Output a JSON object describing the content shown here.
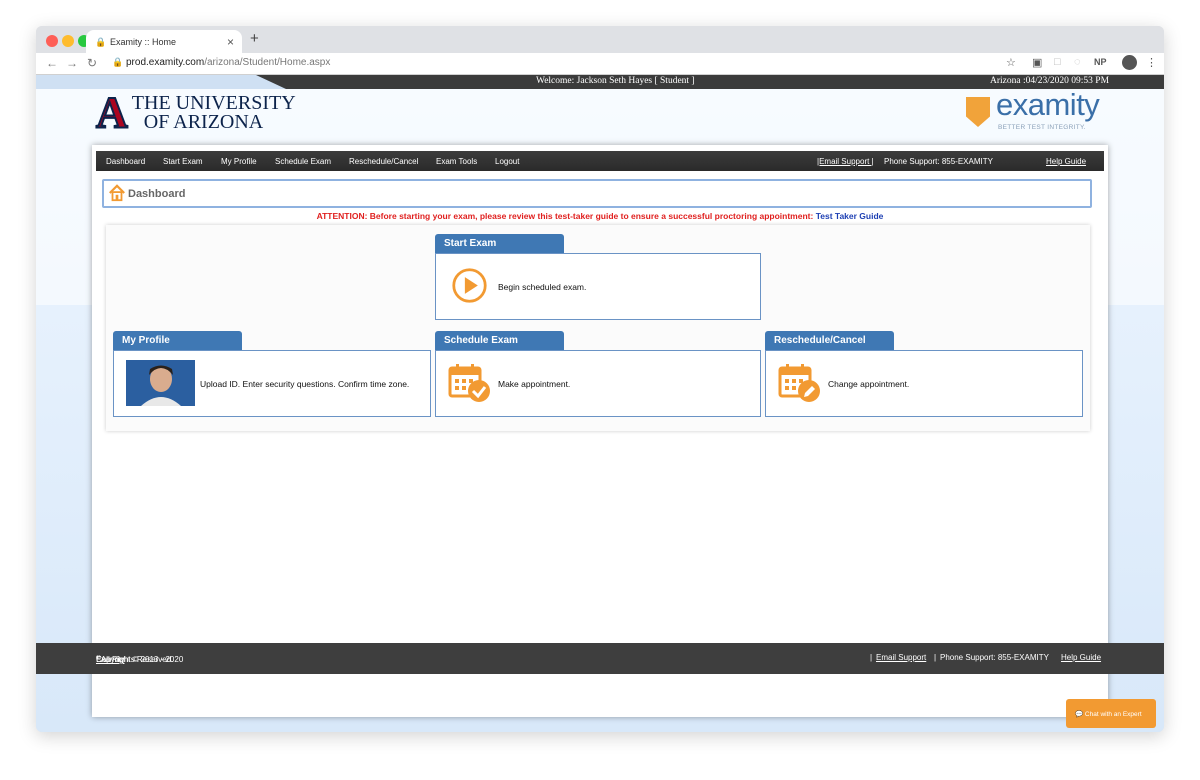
{
  "browser": {
    "tab_title": "Examity :: Home",
    "new_tab": "+",
    "url_host": "prod.examity.com",
    "url_path": "/arizona/Student/Home.aspx",
    "profile_initials": "NP"
  },
  "topbar": {
    "welcome": "Welcome: Jackson Seth Hayes [ Student ]",
    "datetime": "Arizona :04/23/2020 09:53 PM"
  },
  "university_logo": {
    "mark": "A",
    "line1": "THE UNIVERSITY",
    "line2": "OF ARIZONA"
  },
  "examity_logo": {
    "word": "examity",
    "tagline": "BETTER TEST INTEGRITY."
  },
  "menu": {
    "items": [
      "Dashboard",
      "Start Exam",
      "My Profile",
      "Schedule Exam",
      "Reschedule/Cancel",
      "Exam Tools",
      "Logout"
    ],
    "email_support": "|Email Support |",
    "phone_support": "Phone Support: 855-EXAMITY",
    "help_guide": "Help Guide"
  },
  "breadcrumb": {
    "title": "Dashboard"
  },
  "attention": {
    "text": "ATTENTION: Before starting your exam, please review this test-taker guide to ensure a successful proctoring appointment: ",
    "link": "Test Taker Guide"
  },
  "cards": {
    "start_exam": {
      "title": "Start Exam",
      "text": "Begin scheduled exam."
    },
    "my_profile": {
      "title": "My Profile",
      "text": "Upload ID. Enter security questions. Confirm time zone."
    },
    "schedule_exam": {
      "title": "Schedule Exam",
      "text": "Make appointment."
    },
    "reschedule": {
      "title": "Reschedule/Cancel",
      "text": "Change appointment."
    }
  },
  "footer": {
    "copyright_prefix": "Copyright © 2013 - 2020 ",
    "copyright_link": "Examity",
    "copyright_reg": "®",
    "copyright_suffix": " All Rights Reserved.",
    "sep1": "|",
    "email_support": "Email Support",
    "sep2": "|",
    "phone_support": "Phone Support: 855-EXAMITY",
    "help_guide": "Help Guide"
  },
  "chat": {
    "label": "Chat with an Expert"
  },
  "colors": {
    "accent": "#3f78b4",
    "orange": "#f29a32",
    "attention": "#e0201f"
  }
}
